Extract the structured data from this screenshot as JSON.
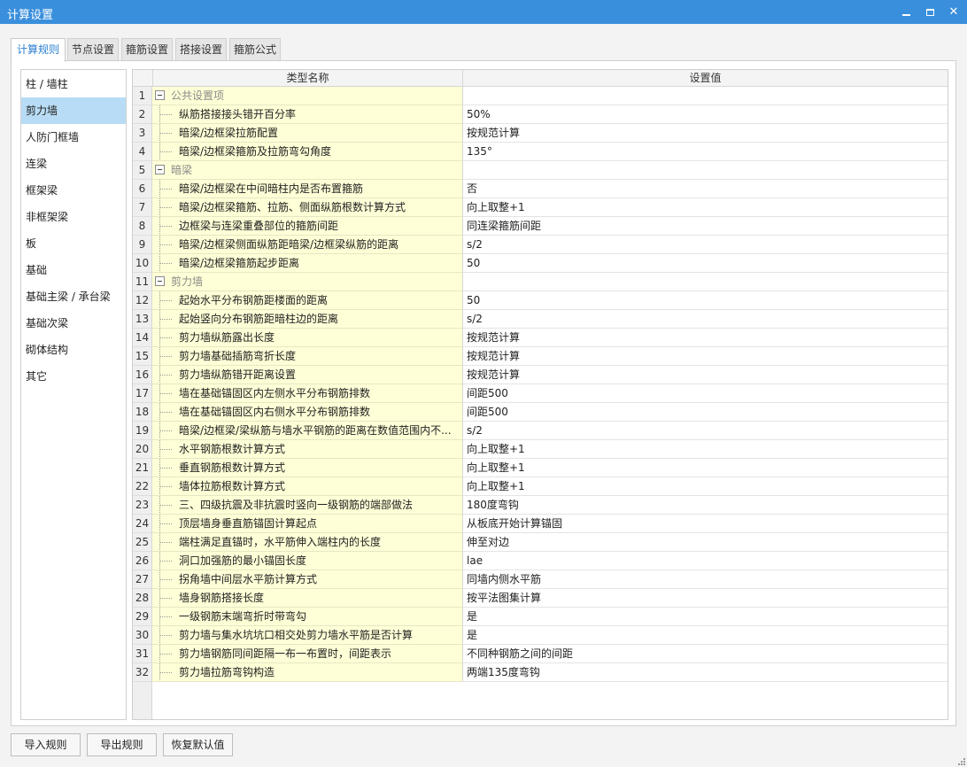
{
  "window": {
    "title": "计算设置",
    "minimize_glyph": "",
    "close_glyph": "✕"
  },
  "tabs": [
    {
      "label": "计算规则",
      "active": true
    },
    {
      "label": "节点设置",
      "active": false
    },
    {
      "label": "箍筋设置",
      "active": false
    },
    {
      "label": "搭接设置",
      "active": false
    },
    {
      "label": "箍筋公式",
      "active": false
    }
  ],
  "sidebar": {
    "selected": "剪力墙",
    "items": [
      {
        "label": "柱 / 墙柱"
      },
      {
        "label": "剪力墙"
      },
      {
        "label": "人防门框墙"
      },
      {
        "label": "连梁"
      },
      {
        "label": "框架梁"
      },
      {
        "label": "非框架梁"
      },
      {
        "label": "板"
      },
      {
        "label": "基础"
      },
      {
        "label": "基础主梁 / 承台梁"
      },
      {
        "label": "基础次梁"
      },
      {
        "label": "砌体结构"
      },
      {
        "label": "其它"
      }
    ]
  },
  "grid": {
    "headers": {
      "name": "类型名称",
      "value": "设置值"
    },
    "rows": [
      {
        "num": "1",
        "name": "公共设置项",
        "value": "",
        "group": true
      },
      {
        "num": "2",
        "name": "纵筋搭接接头错开百分率",
        "value": "50%",
        "group": false
      },
      {
        "num": "3",
        "name": "暗梁/边框梁拉筋配置",
        "value": "按规范计算",
        "group": false
      },
      {
        "num": "4",
        "name": "暗梁/边框梁箍筋及拉筋弯勾角度",
        "value": "135°",
        "group": false
      },
      {
        "num": "5",
        "name": "暗梁",
        "value": "",
        "group": true
      },
      {
        "num": "6",
        "name": "暗梁/边框梁在中间暗柱内是否布置箍筋",
        "value": "否",
        "group": false
      },
      {
        "num": "7",
        "name": "暗梁/边框梁箍筋、拉筋、侧面纵筋根数计算方式",
        "value": "向上取整+1",
        "group": false
      },
      {
        "num": "8",
        "name": "边框梁与连梁重叠部位的箍筋间距",
        "value": "同连梁箍筋间距",
        "group": false
      },
      {
        "num": "9",
        "name": "暗梁/边框梁侧面纵筋距暗梁/边框梁纵筋的距离",
        "value": "s/2",
        "group": false
      },
      {
        "num": "10",
        "name": "暗梁/边框梁箍筋起步距离",
        "value": "50",
        "group": false
      },
      {
        "num": "11",
        "name": "剪力墙",
        "value": "",
        "group": true
      },
      {
        "num": "12",
        "name": "起始水平分布钢筋距楼面的距离",
        "value": "50",
        "group": false
      },
      {
        "num": "13",
        "name": "起始竖向分布钢筋距暗柱边的距离",
        "value": "s/2",
        "group": false
      },
      {
        "num": "14",
        "name": "剪力墙纵筋露出长度",
        "value": "按规范计算",
        "group": false
      },
      {
        "num": "15",
        "name": "剪力墙基础插筋弯折长度",
        "value": "按规范计算",
        "group": false
      },
      {
        "num": "16",
        "name": "剪力墙纵筋错开距离设置",
        "value": "按规范计算",
        "group": false
      },
      {
        "num": "17",
        "name": "墙在基础锚固区内左侧水平分布钢筋排数",
        "value": "间距500",
        "group": false
      },
      {
        "num": "18",
        "name": "墙在基础锚固区内右侧水平分布钢筋排数",
        "value": "间距500",
        "group": false
      },
      {
        "num": "19",
        "name": "暗梁/边框梁/梁纵筋与墙水平钢筋的距离在数值范围内不...",
        "value": "s/2",
        "group": false
      },
      {
        "num": "20",
        "name": "水平钢筋根数计算方式",
        "value": "向上取整+1",
        "group": false
      },
      {
        "num": "21",
        "name": "垂直钢筋根数计算方式",
        "value": "向上取整+1",
        "group": false
      },
      {
        "num": "22",
        "name": "墙体拉筋根数计算方式",
        "value": "向上取整+1",
        "group": false
      },
      {
        "num": "23",
        "name": "三、四级抗震及非抗震时竖向一级钢筋的端部做法",
        "value": "180度弯钩",
        "group": false
      },
      {
        "num": "24",
        "name": "顶层墙身垂直筋锚固计算起点",
        "value": "从板底开始计算锚固",
        "group": false
      },
      {
        "num": "25",
        "name": "端柱满足直锚时，水平筋伸入端柱内的长度",
        "value": "伸至对边",
        "group": false
      },
      {
        "num": "26",
        "name": "洞口加强筋的最小锚固长度",
        "value": "lae",
        "group": false
      },
      {
        "num": "27",
        "name": "拐角墙中间层水平筋计算方式",
        "value": "同墙内侧水平筋",
        "group": false
      },
      {
        "num": "28",
        "name": "墙身钢筋搭接长度",
        "value": "按平法图集计算",
        "group": false
      },
      {
        "num": "29",
        "name": "一级钢筋末端弯折时带弯勾",
        "value": "是",
        "group": false
      },
      {
        "num": "30",
        "name": "剪力墙与集水坑坑口相交处剪力墙水平筋是否计算",
        "value": "是",
        "group": false
      },
      {
        "num": "31",
        "name": "剪力墙钢筋同间距隔一布一布置时，间距表示",
        "value": "不同种钢筋之间的间距",
        "group": false
      },
      {
        "num": "32",
        "name": "剪力墙拉筋弯钩构造",
        "value": "两端135度弯钩",
        "group": false
      }
    ]
  },
  "footer": {
    "import_label": "导入规则",
    "export_label": "导出规则",
    "restore_label": "恢复默认值"
  },
  "colors": {
    "titlebar": "#3a8fdc",
    "selected_sidebar": "#b8dcf5",
    "name_cell": "#ffffd7",
    "active_tab_text": "#2b7fd0"
  }
}
